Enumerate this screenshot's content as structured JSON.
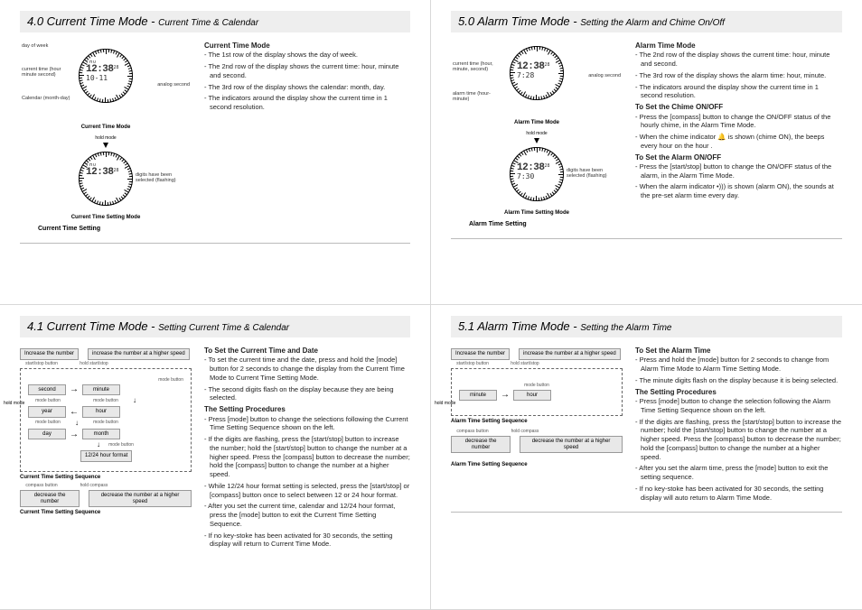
{
  "q1": {
    "title_main": "4.0 Current Time Mode - ",
    "title_sub": "Current Time & Calendar",
    "heading": "Current Time Mode",
    "items": [
      "The 1st row of the display shows the day of week.",
      "The 2nd row of the display shows the current time: hour, minute and second.",
      "The 3rd row of the display shows the calendar: month, day.",
      "The indicators around the display show the current time in 1 second resolution."
    ],
    "labels": {
      "day_of_week": "day of week",
      "current_time": "current time (hour minute second)",
      "calendar": "Calendar (month-day)",
      "analog_second": "analog second",
      "hold_mode": "hold mode",
      "digits_selected": "digits have been selected (flashing)"
    },
    "lcd": {
      "r1": "THU",
      "r2": "12:38",
      "r2s": "28",
      "r3": "10-11"
    },
    "lcd2": {
      "r1": "THU",
      "r2": "12:38",
      "r2s": "28"
    },
    "cap1": "Current Time Mode",
    "cap2": "Current Time Setting Mode",
    "cap3": "Current Time Setting"
  },
  "q2": {
    "title_main": "5.0 Alarm Time Mode - ",
    "title_sub": "Setting the Alarm and Chime On/Off",
    "heading1": "Alarm Time Mode",
    "items1": [
      "The 2nd row of the display shows the current time: hour, minute and second.",
      "The 3rd row of the display shows the alarm time: hour, minute.",
      "The indicators around the display show the current time in 1 second resolution."
    ],
    "heading2": "To Set the Chime ON/OFF",
    "items2": [
      "Press the [compass] button to change the ON/OFF status of the hourly chime, in the Alarm Time Mode.",
      "When the chime indicator 🔔 is shown (chime ON), the beeps every hour on the hour ."
    ],
    "heading3": "To Set the Alarm ON/OFF",
    "items3": [
      "Press the [start/stop] button to change the ON/OFF status of the alarm, in the Alarm Time Mode.",
      "When the alarm indicator •))) is shown (alarm ON), the sounds at the pre-set alarm time every day."
    ],
    "labels": {
      "current_time": "current time (hour, minute, second)",
      "alarm_time": "alarm time (hour-minute)",
      "analog_second": "analog second",
      "hold_mode": "hold mode",
      "digits_selected": "digits have been selected (flashing)"
    },
    "lcd": {
      "r2": "12:38",
      "r2s": "28",
      "r3": "7:28"
    },
    "lcd2": {
      "r2": "12:38",
      "r2s": "28",
      "r3": "7:30"
    },
    "cap1": "Alarm Time Mode",
    "cap2": "Alarm Time Setting Mode",
    "cap3": "Alarm Time Setting"
  },
  "q3": {
    "title_main": "4.1 Current Time Mode - ",
    "title_sub": "Setting Current Time & Calendar",
    "heading1": "To Set the Current Time and Date",
    "items1": [
      "To set the current time and the date, press and hold the [mode] button for 2 seconds to change the display from the Current Time Mode to Current Time Setting Mode.",
      "The second digits flash on the display because they are being selected."
    ],
    "heading2": "The Setting Procedures",
    "items2": [
      "Press [mode] button to change the selections following the Current Time Setting Sequence shown on the left.",
      "If the digits are flashing, press the [start/stop] button to increase the number; hold the [start/stop] button to change the number at a higher speed. Press the [compass] button to decrease the number; hold the [compass] button to change the number at a higher speed.",
      "While 12/24 hour format setting is selected, press the [start/stop] or [compass] button once to select between 12 or 24 hour format.",
      "After you set the current time, calendar and 12/24 hour format, press the [mode] button to exit the Current Time Setting Sequence.",
      "If no key-stoke has been activated for 30 seconds, the setting display will return to Current Time Mode."
    ],
    "labels": {
      "increase": "Increase the number",
      "increase_fast": "increase the number at a higher speed",
      "decrease": "decrease the number",
      "decrease_fast": "decrease the number at a higher speed",
      "start_stop": "start/stop button",
      "hold_start_stop": "hold start/stop",
      "compass": "compass button",
      "hold_compass": "hold compass",
      "mode_button": "mode button",
      "hold_mode": "hold mode"
    },
    "seq": [
      "second",
      "minute",
      "year",
      "hour",
      "day",
      "month",
      "12/24 hour format"
    ],
    "cap_seq": "Current Time Setting Sequence",
    "cap_seq2": "Current Time Setting Sequence"
  },
  "q4": {
    "title_main": "5.1 Alarm Time Mode - ",
    "title_sub": "Setting the Alarm Time",
    "heading1": "To Set the Alarm Time",
    "items1": [
      "Press and hold the [mode] button for 2 seconds to change from Alarm Time Mode to Alarm Time Setting Mode.",
      "The minute digits flash on the display because it is being selected."
    ],
    "heading2": "The Setting Procedures",
    "items2": [
      "Press [mode] button to change the selection following the Alarm Time Setting Sequence shown on the left.",
      "If the digits are flashing, press the [start/stop] button to increase the number; hold the [start/stop] button to change the number at a higher speed. Press the [compass] button to decrease the number; hold the [compass] button to change the number at a higher speed.",
      "After you set the alarm time, press the [mode] button to exit the setting sequence.",
      "If no key-stoke has been activated for 30 seconds, the setting display will auto return to Alarm Time Mode."
    ],
    "labels": {
      "increase": "Increase the number",
      "increase_fast": "increase the number at a higher speed",
      "decrease": "decrease the number",
      "decrease_fast": "decrease the number at a higher speed",
      "start_stop": "start/stop button",
      "hold_start_stop": "hold start/stop",
      "compass": "compass button",
      "hold_compass": "hold compass",
      "mode_button": "mode button",
      "hold_mode": "hold mode"
    },
    "seq": [
      "minute",
      "hour"
    ],
    "cap_seq": "Alarm Time Setting Sequence",
    "cap_seq2": "Alarm Time Setting Sequence"
  }
}
